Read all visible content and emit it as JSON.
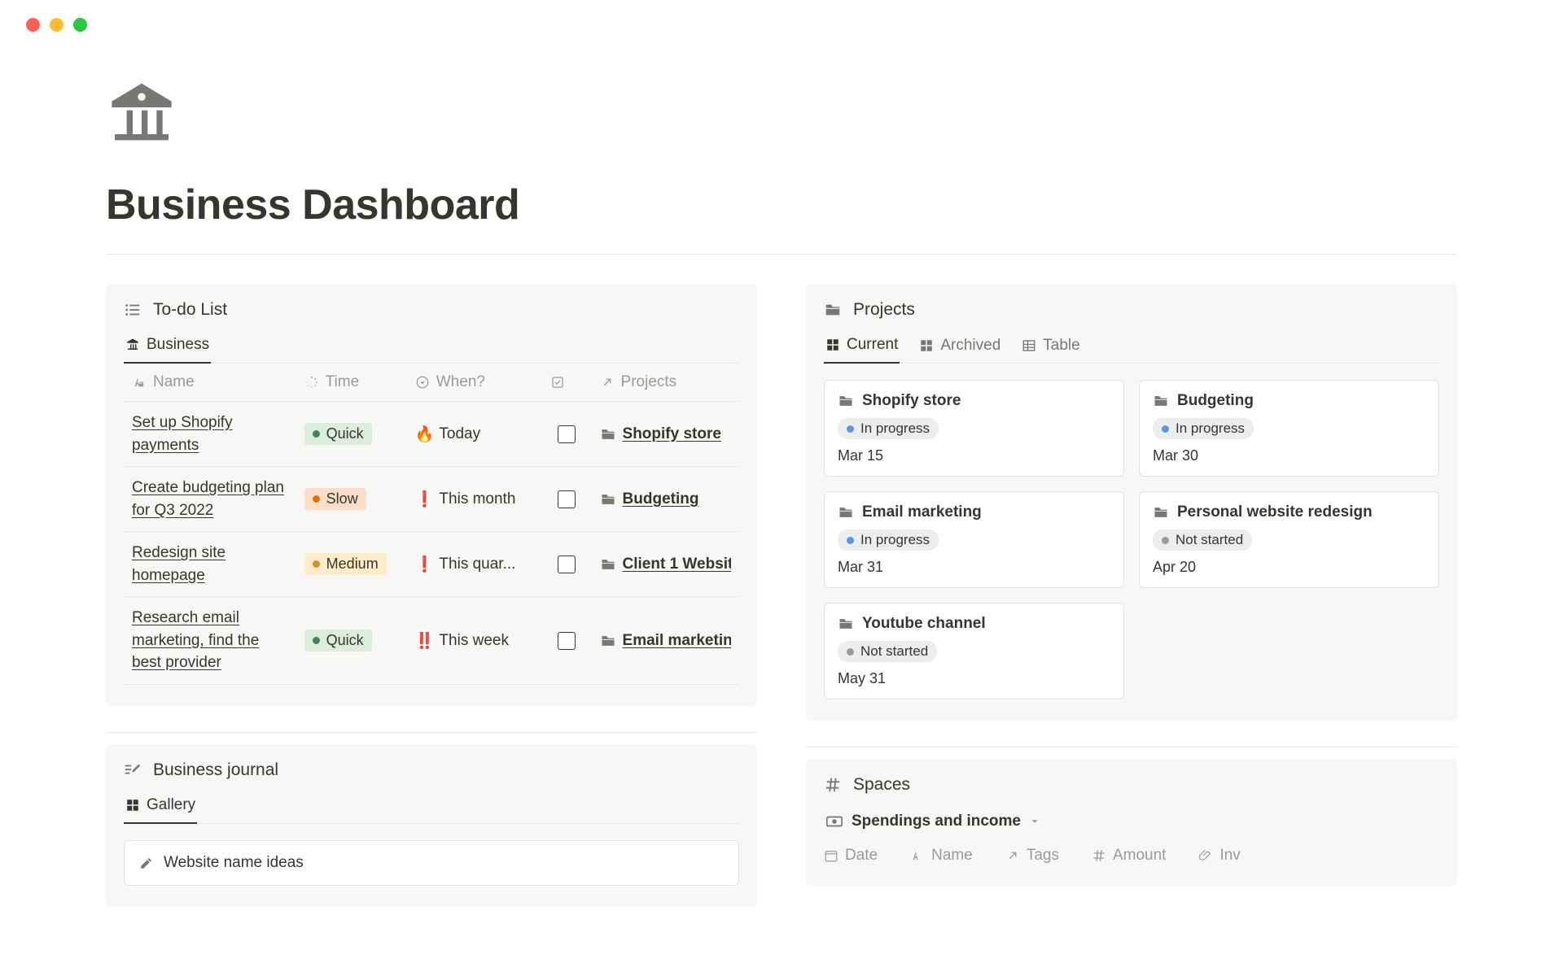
{
  "title": "Business Dashboard",
  "todo": {
    "panel_title": "To-do List",
    "tabs": [
      {
        "label": "Business",
        "active": true
      }
    ],
    "columns": {
      "name": "Name",
      "time": "Time",
      "when": "When?",
      "projects": "Projects"
    },
    "rows": [
      {
        "name": "Set up Shopify payments",
        "time": "Quick",
        "time_class": "quick",
        "when_icon": "🔥",
        "when": "Today",
        "project": "Shopify store"
      },
      {
        "name": "Create budgeting plan for Q3 2022",
        "time": "Slow",
        "time_class": "slow",
        "when_icon": "❗",
        "when": "This month",
        "project": "Budgeting"
      },
      {
        "name": "Redesign site homepage",
        "time": "Medium",
        "time_class": "medium",
        "when_icon": "❗",
        "when": "This quar...",
        "project": "Client 1 Websit"
      },
      {
        "name": "Research email marketing, find the best provider",
        "time": "Quick",
        "time_class": "quick",
        "when_icon": "‼️",
        "when": "This week",
        "project": "Email marketing"
      }
    ]
  },
  "projects": {
    "panel_title": "Projects",
    "tabs": [
      {
        "label": "Current",
        "icon": "board",
        "active": true
      },
      {
        "label": "Archived",
        "icon": "board",
        "active": false
      },
      {
        "label": "Table",
        "icon": "table",
        "active": false
      }
    ],
    "cards": [
      {
        "title": "Shopify store",
        "status": "In progress",
        "status_class": "inprog",
        "date": "Mar 15"
      },
      {
        "title": "Budgeting",
        "status": "In progress",
        "status_class": "inprog",
        "date": "Mar 30"
      },
      {
        "title": "Email marketing",
        "status": "In progress",
        "status_class": "inprog",
        "date": "Mar 31"
      },
      {
        "title": "Personal website redesign",
        "status": "Not started",
        "status_class": "notstarted",
        "date": "Apr 20"
      },
      {
        "title": "Youtube channel",
        "status": "Not started",
        "status_class": "notstarted",
        "date": "May 31"
      }
    ]
  },
  "journal": {
    "panel_title": "Business journal",
    "tab": "Gallery",
    "card": "Website name ideas"
  },
  "spaces": {
    "panel_title": "Spaces",
    "view": "Spendings and income",
    "headers": {
      "date": "Date",
      "name": "Name",
      "tags": "Tags",
      "amount": "Amount",
      "invoice": "Inv"
    }
  }
}
